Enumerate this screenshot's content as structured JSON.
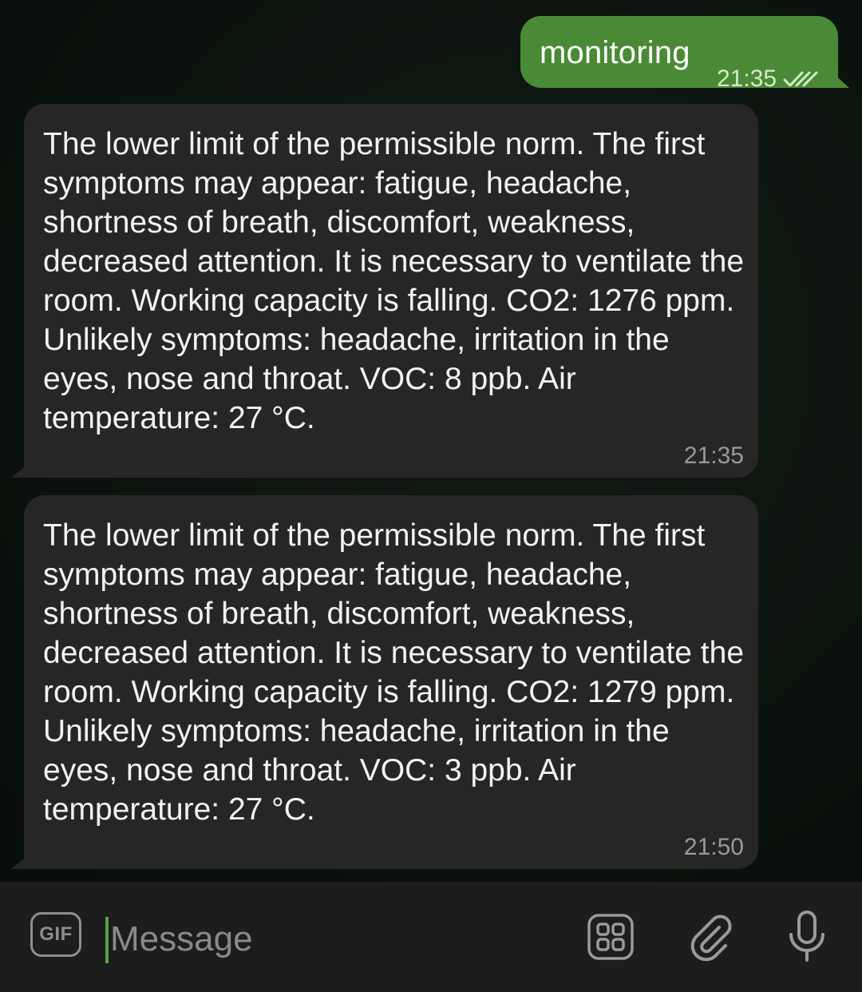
{
  "messages": [
    {
      "direction": "outgoing",
      "text": "monitoring",
      "time": "21:35",
      "status_icon": "double-check-icon"
    },
    {
      "direction": "incoming",
      "text": "The lower limit of the permissible norm. The first symptoms may appear: fatigue, headache, shortness of breath, discomfort, weakness, decreased attention. It is necessary to ventilate the room. Working capacity is falling. CO2: 1276 ppm. Unlikely symptoms: headache, irritation in the eyes, nose and throat. VOC: 8 ppb. Air temperature: 27 °C.",
      "time": "21:35"
    },
    {
      "direction": "incoming",
      "text": "The lower limit of the permissible norm. The first symptoms may appear: fatigue, headache, shortness of breath, discomfort, weakness, decreased attention. It is necessary to ventilate the room. Working capacity is falling. CO2: 1279 ppm. Unlikely symptoms: headache, irritation in the eyes, nose and throat. VOC: 3 ppb. Air temperature: 27 °C.",
      "time": "21:50"
    }
  ],
  "input_bar": {
    "gif_label": "GIF",
    "placeholder": "Message",
    "value": "",
    "icons": [
      "gif-icon",
      "apps-grid-icon",
      "paperclip-icon",
      "microphone-icon"
    ]
  },
  "colors": {
    "background": "#0c140f",
    "outgoing_bubble": "#4a8a36",
    "incoming_bubble": "#262626",
    "input_bar": "#1d1d1d",
    "accent_cursor": "#58a33f"
  }
}
